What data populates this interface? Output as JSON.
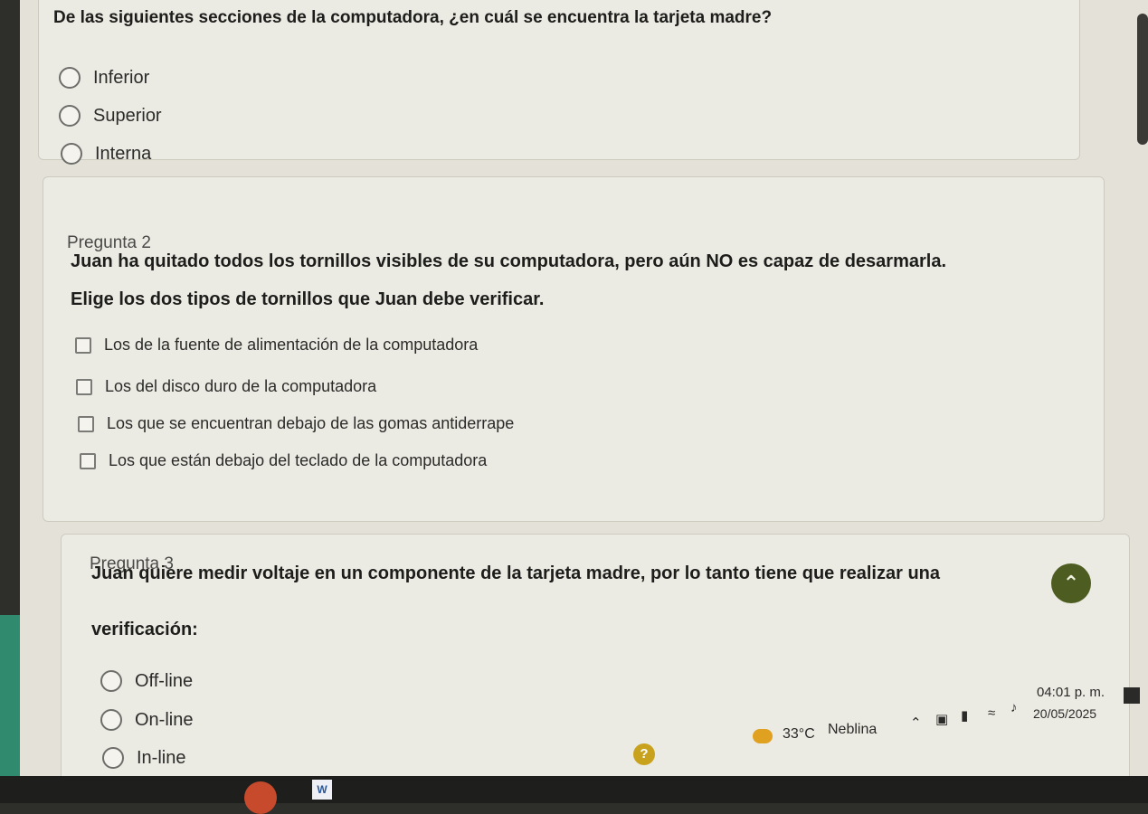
{
  "q1": {
    "text": "De las siguientes secciones de la computadora, ¿en cuál se encuentra la tarjeta madre?",
    "options": [
      "Inferior",
      "Superior",
      "Interna"
    ]
  },
  "q2": {
    "label": "Pregunta 2",
    "line1": "Juan ha quitado todos los tornillos visibles de su computadora, pero aún NO es capaz de desarmarla.",
    "line2": "Elige los dos tipos de tornillos que Juan debe verificar.",
    "options": [
      "Los de la fuente de alimentación de la computadora",
      "Los del disco duro de la computadora",
      "Los que se encuentran debajo de las gomas antiderrape",
      "Los que están debajo del teclado de la computadora"
    ]
  },
  "q3": {
    "label": "Pregunta 3",
    "line1": "Juan quiere medir voltaje en un componente de la tarjeta madre, por lo tanto tiene que realizar una",
    "line2": "verificación:",
    "options": [
      "Off-line",
      "On-line",
      "In-line"
    ]
  },
  "taskbar": {
    "temperature": "33°C",
    "weather": "Neblina",
    "time": "04:01 p. m.",
    "date": "20/05/2025"
  },
  "colors": {
    "accent": "#4d5d22",
    "background": "#e4e2d8"
  }
}
